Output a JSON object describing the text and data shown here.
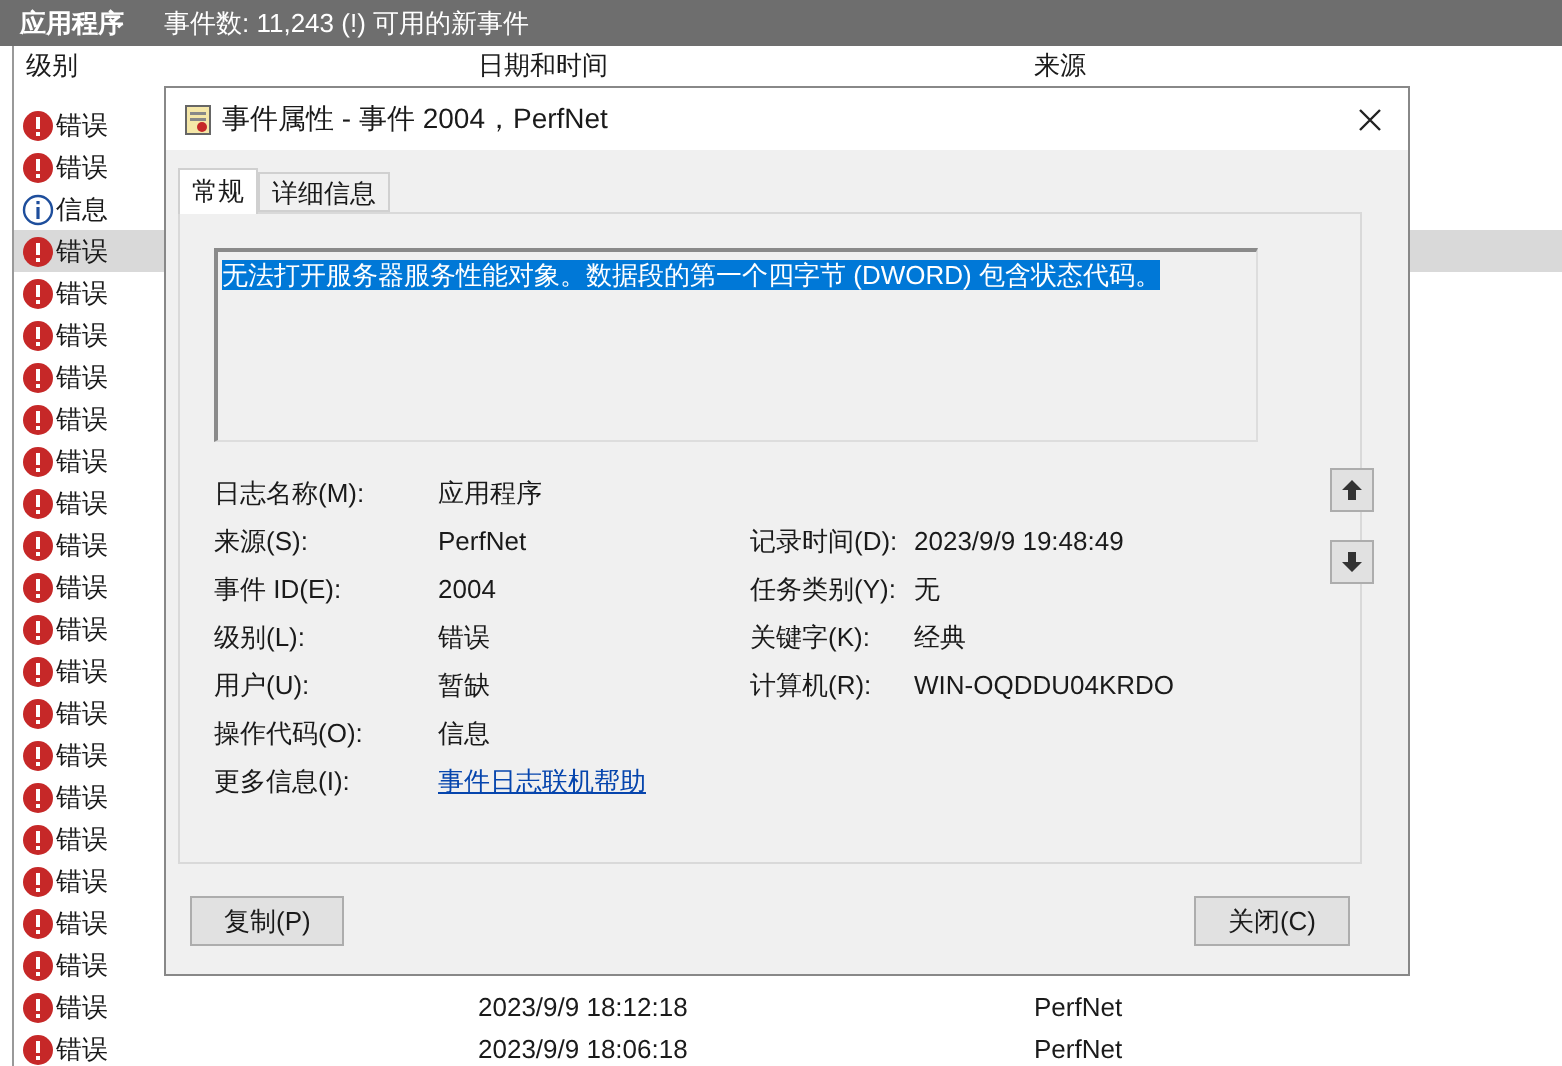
{
  "top_bar": {
    "title": "应用程序",
    "summary": "事件数: 11,243 (!) 可用的新事件"
  },
  "table": {
    "columns": [
      "级别",
      "日期和时间",
      "来源"
    ],
    "rows": [
      {
        "kind": "error",
        "level": "错误",
        "selected": false
      },
      {
        "kind": "error",
        "level": "错误",
        "selected": false
      },
      {
        "kind": "info",
        "level": "信息",
        "selected": false
      },
      {
        "kind": "error",
        "level": "错误",
        "selected": true
      },
      {
        "kind": "error",
        "level": "错误",
        "selected": false
      },
      {
        "kind": "error",
        "level": "错误",
        "selected": false
      },
      {
        "kind": "error",
        "level": "错误",
        "selected": false
      },
      {
        "kind": "error",
        "level": "错误",
        "selected": false
      },
      {
        "kind": "error",
        "level": "错误",
        "selected": false
      },
      {
        "kind": "error",
        "level": "错误",
        "selected": false
      },
      {
        "kind": "error",
        "level": "错误",
        "selected": false
      },
      {
        "kind": "error",
        "level": "错误",
        "selected": false
      },
      {
        "kind": "error",
        "level": "错误",
        "selected": false
      },
      {
        "kind": "error",
        "level": "错误",
        "selected": false
      },
      {
        "kind": "error",
        "level": "错误",
        "selected": false
      },
      {
        "kind": "error",
        "level": "错误",
        "selected": false
      },
      {
        "kind": "error",
        "level": "错误",
        "selected": false
      },
      {
        "kind": "error",
        "level": "错误",
        "selected": false
      },
      {
        "kind": "error",
        "level": "错误",
        "selected": false
      },
      {
        "kind": "error",
        "level": "错误",
        "selected": false
      },
      {
        "kind": "error",
        "level": "错误",
        "selected": false
      },
      {
        "kind": "error",
        "level": "错误",
        "selected": false,
        "date": "2023/9/9 18:12:18",
        "source": "PerfNet"
      },
      {
        "kind": "error",
        "level": "错误",
        "selected": false,
        "date": "2023/9/9 18:06:18",
        "source": "PerfNet"
      }
    ]
  },
  "dialog": {
    "title": "事件属性 - 事件 2004，PerfNet",
    "tabs": [
      {
        "label": "常规",
        "selected": true
      },
      {
        "label": "详细信息",
        "selected": false
      }
    ],
    "message": "无法打开服务器服务性能对象。数据段的第一个四字节 (DWORD) 包含状态代码。",
    "fields_left": [
      {
        "label": "日志名称(M):",
        "value": "应用程序"
      },
      {
        "label": "来源(S):",
        "value": "PerfNet"
      },
      {
        "label": "事件 ID(E):",
        "value": "2004"
      },
      {
        "label": "级别(L):",
        "value": "错误"
      },
      {
        "label": "用户(U):",
        "value": "暂缺"
      },
      {
        "label": "操作代码(O):",
        "value": "信息"
      },
      {
        "label": "更多信息(I):",
        "value": "事件日志联机帮助",
        "kind": "link"
      }
    ],
    "fields_right": [
      {
        "label": "记录时间(D):",
        "value": "2023/9/9 19:48:49"
      },
      {
        "label": "任务类别(Y):",
        "value": "无"
      },
      {
        "label": "关键字(K):",
        "value": "经典"
      },
      {
        "label": "计算机(R):",
        "value": "WIN-OQDDU04KRDO"
      }
    ],
    "buttons": [
      "复制(P)",
      "关闭(C)"
    ]
  }
}
